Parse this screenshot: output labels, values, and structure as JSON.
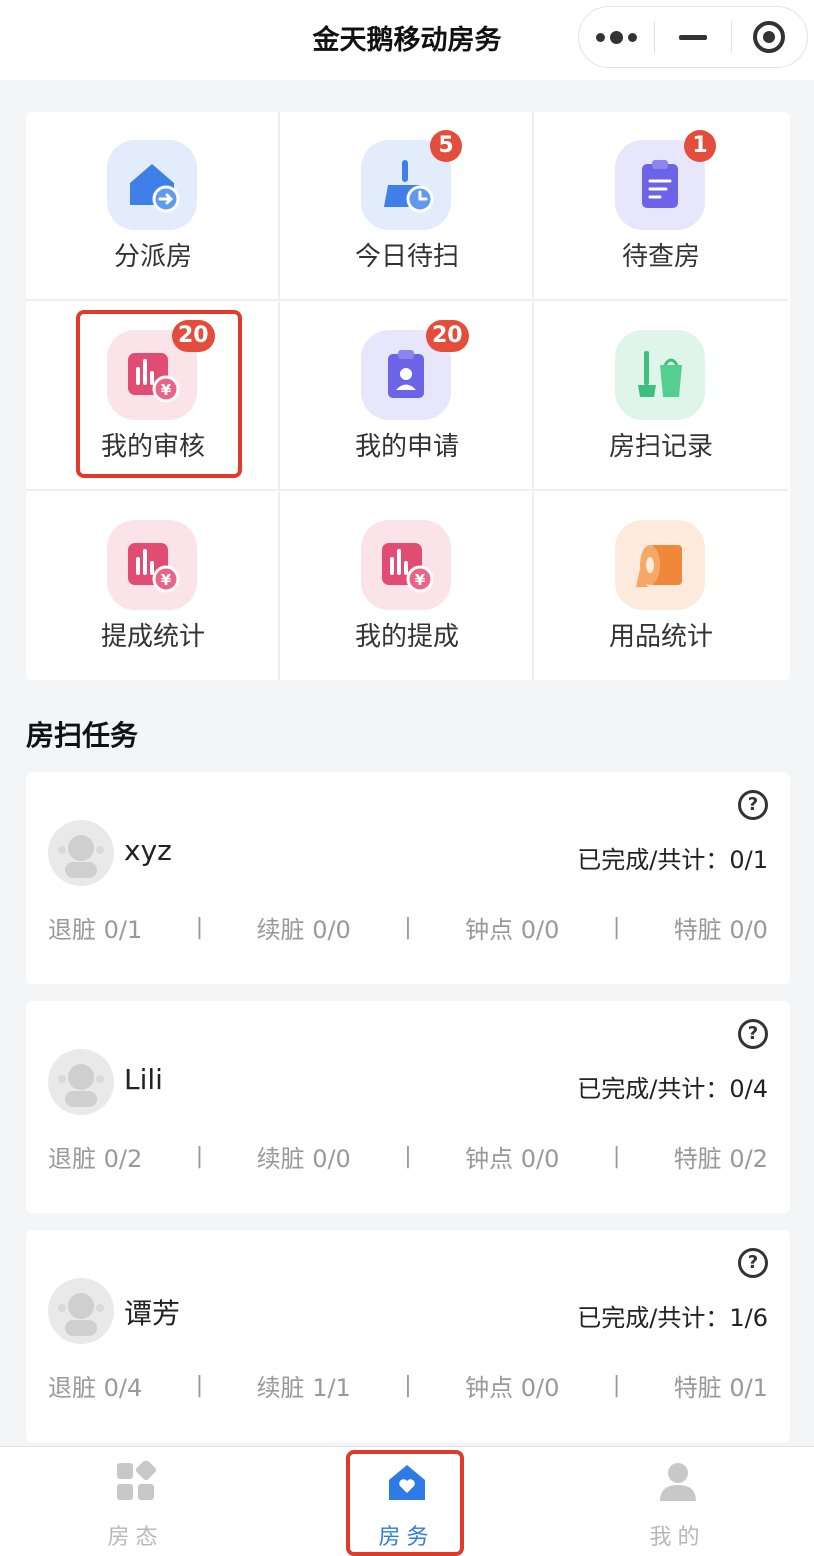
{
  "app": {
    "title": "金天鹅移动房务",
    "capsule": {
      "more_icon": "more-dots-icon",
      "minimize_icon": "minimize-icon",
      "close_icon": "target-close-icon"
    }
  },
  "menu": [
    {
      "label": "分派房",
      "icon": "house-assign-icon",
      "badge": null
    },
    {
      "label": "今日待扫",
      "icon": "broom-clock-icon",
      "badge": "5"
    },
    {
      "label": "待查房",
      "icon": "clipboard-icon",
      "badge": "1"
    },
    {
      "label": "我的审核",
      "icon": "chart-yen-icon",
      "badge": "20",
      "highlighted": true
    },
    {
      "label": "我的申请",
      "icon": "id-badge-icon",
      "badge": "20"
    },
    {
      "label": "房扫记录",
      "icon": "mop-bucket-icon",
      "badge": null
    },
    {
      "label": "提成统计",
      "icon": "chart-yen-icon",
      "badge": null
    },
    {
      "label": "我的提成",
      "icon": "chart-yen-icon",
      "badge": null
    },
    {
      "label": "用品统计",
      "icon": "tissue-roll-icon",
      "badge": null
    }
  ],
  "tasks": {
    "title": "房扫任务",
    "progress_label": "已完成/共计：",
    "items": [
      {
        "name": "xyz",
        "progress": "0/1",
        "stats": [
          {
            "label": "退脏",
            "value": "0/1"
          },
          {
            "label": "续脏",
            "value": "0/0"
          },
          {
            "label": "钟点",
            "value": "0/0"
          },
          {
            "label": "特脏",
            "value": "0/0"
          }
        ]
      },
      {
        "name": "Lili",
        "progress": "0/4",
        "stats": [
          {
            "label": "退脏",
            "value": "0/2"
          },
          {
            "label": "续脏",
            "value": "0/0"
          },
          {
            "label": "钟点",
            "value": "0/0"
          },
          {
            "label": "特脏",
            "value": "0/2"
          }
        ]
      },
      {
        "name": "谭芳",
        "progress": "1/6",
        "stats": [
          {
            "label": "退脏",
            "value": "0/4"
          },
          {
            "label": "续脏",
            "value": "1/1"
          },
          {
            "label": "钟点",
            "value": "0/0"
          },
          {
            "label": "特脏",
            "value": "0/1"
          }
        ]
      }
    ]
  },
  "tabbar": [
    {
      "label": "房态",
      "icon": "room-status-icon",
      "active": false
    },
    {
      "label": "房务",
      "icon": "house-heart-icon",
      "active": true
    },
    {
      "label": "我的",
      "icon": "user-icon",
      "active": false
    }
  ],
  "colors": {
    "accent": "#2e7be6",
    "badge": "#e44c3c",
    "highlight": "#e23a2a"
  }
}
